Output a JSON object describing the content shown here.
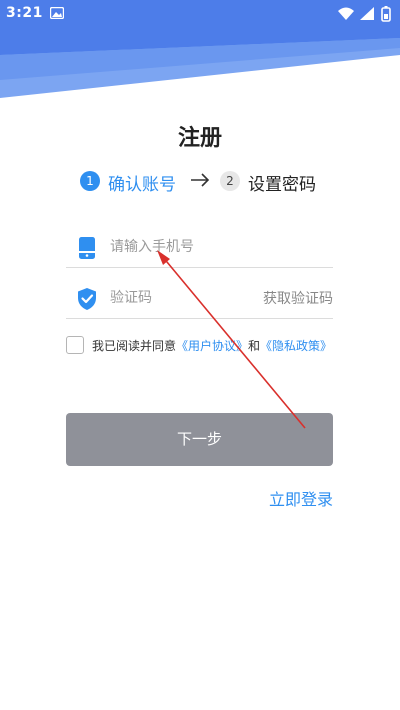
{
  "status_bar": {
    "time": "3:21",
    "icons": [
      "image-notification-icon",
      "wifi-icon",
      "signal-icon",
      "battery-icon"
    ]
  },
  "page": {
    "title": "注册"
  },
  "steps": [
    {
      "number": "1",
      "label": "确认账号",
      "active": true
    },
    {
      "number": "2",
      "label": "设置密码",
      "active": false
    }
  ],
  "form": {
    "phone": {
      "placeholder": "请输入手机号",
      "value": "",
      "icon": "phone-icon"
    },
    "code": {
      "placeholder": "验证码",
      "value": "",
      "icon": "shield-check-icon",
      "get_code_label": "获取验证码"
    }
  },
  "agreement": {
    "checked": false,
    "prefix": "我已阅读并同意",
    "user_agreement": "《用户协议》",
    "conjunction": "和",
    "privacy_policy": "《隐私政策》"
  },
  "actions": {
    "next_label": "下一步",
    "login_label": "立即登录"
  },
  "colors": {
    "accent": "#2f8ff0",
    "header_blue": "#5f8ff0",
    "button_disabled": "#8f9199",
    "annotation_red": "#d9302c"
  }
}
